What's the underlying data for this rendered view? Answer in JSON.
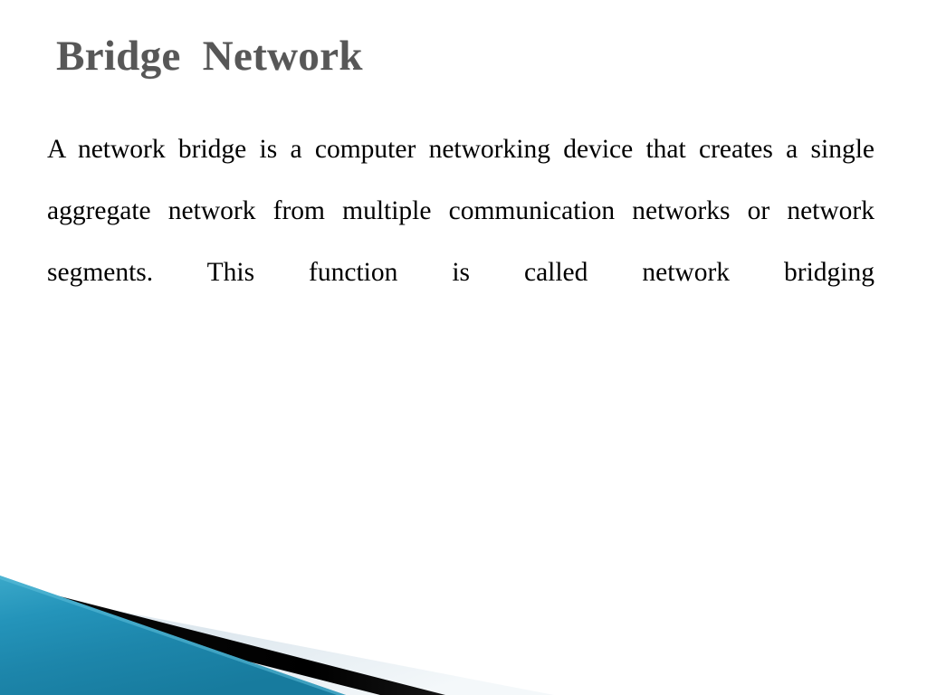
{
  "slide": {
    "title": "Bridge  Network",
    "body_paragraph": "A network bridge is a computer networking device that creates a single aggregate network from multiple communication networks or network segments. This function is called network bridging",
    "body_lines": [
      "A network bridge is a computer networking device that",
      "creates a single aggregate network from multiple",
      "communication networks or network segments. This",
      "function is called network bridging"
    ],
    "background_color": "#ffffff",
    "title_color": "#575757",
    "body_color": "#000000"
  },
  "decoration": {
    "name": "bottom-left-diagonal-banner",
    "teal_light": "#3aa8c9",
    "teal_mid": "#1d86ab",
    "teal_dark": "#16748f",
    "black_stripe": "#000000",
    "pale_blue": "#dde7ee",
    "pale_blue_light": "#f0f5f8"
  }
}
